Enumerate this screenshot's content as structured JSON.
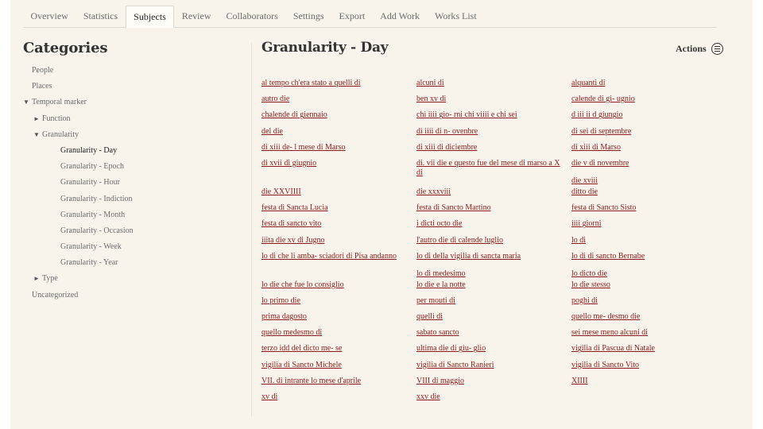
{
  "tabs": [
    "Overview",
    "Statistics",
    "Subjects",
    "Review",
    "Collaborators",
    "Settings",
    "Export",
    "Add Work",
    "Works List"
  ],
  "active_tab": "Subjects",
  "sidebar": {
    "title": "Categories",
    "items": [
      {
        "label": "People",
        "indent": 0,
        "toggle": ""
      },
      {
        "label": "Places",
        "indent": 0,
        "toggle": ""
      },
      {
        "label": "Temporal marker",
        "indent": 0,
        "toggle": "▼"
      },
      {
        "label": "Function",
        "indent": 1,
        "toggle": "►"
      },
      {
        "label": "Granularity",
        "indent": 1,
        "toggle": "▼"
      },
      {
        "label": "Granularity - Day",
        "indent": 2,
        "toggle": "",
        "current": true
      },
      {
        "label": "Granularity - Epoch",
        "indent": 2,
        "toggle": ""
      },
      {
        "label": "Granularity - Hour",
        "indent": 2,
        "toggle": ""
      },
      {
        "label": "Granularity - Indiction",
        "indent": 2,
        "toggle": ""
      },
      {
        "label": "Granularity - Month",
        "indent": 2,
        "toggle": ""
      },
      {
        "label": "Granularity - Occasion",
        "indent": 2,
        "toggle": ""
      },
      {
        "label": "Granularity - Week",
        "indent": 2,
        "toggle": ""
      },
      {
        "label": "Granularity - Year",
        "indent": 2,
        "toggle": ""
      },
      {
        "label": "Type",
        "indent": 1,
        "toggle": "►"
      },
      {
        "label": "Uncategorized",
        "indent": 0,
        "toggle": ""
      }
    ]
  },
  "main": {
    "title": "Granularity - Day",
    "actions_label": "Actions",
    "actions_icon": "menu-circle-icon",
    "link_color": "#8b1a1a"
  },
  "rows": [
    [
      "al tempo ch'era stato a quelli di",
      "alcuni di",
      "alquanti di"
    ],
    [
      "autro die",
      "ben xv di",
      "calende di gi- ugnio"
    ],
    [
      "chalende di giennaio",
      "chi iiii gio- rni chi viiii e chi sei",
      "d iii ii d giungio"
    ],
    [
      "del die",
      "di iiii di n- ovenbre",
      "di sei di septembre"
    ],
    [
      "di xiii de- l mese di Marso",
      "di xiii di diciembre",
      "di xiii di Marso"
    ],
    [
      "di xvii di giugnio",
      "di. vii die e questo fue del mese di marso a X di",
      [
        "die v di novembre",
        "die xviii"
      ]
    ],
    [
      "die XXVIIII",
      "die xxxviii",
      "ditto die"
    ],
    [
      "festa di Sancta Lucia",
      "festa di Sancto Martino",
      "festa di Sancto Sisto"
    ],
    [
      "festa di sancto vito",
      "i dicti octo die",
      "iiii giorni"
    ],
    [
      "iiita die xv di Jugno",
      "l'autro die di calende luglio",
      "lo di"
    ],
    [
      "lo di che li amba- sciadori di Pisa andanno",
      [
        "lo di della vigilia di sancta maria",
        "lo di medesimo"
      ],
      [
        "lo di di sancto Bernabe",
        "lo dicto die"
      ]
    ],
    [
      "lo die che fue lo consiglio",
      "lo die e la notte",
      "lo die stesso"
    ],
    [
      "lo primo die",
      "per mouti di",
      "poghi di"
    ],
    [
      "prima dagosto",
      "quelli di",
      "quello me- desmo die"
    ],
    [
      "quello medesmo di",
      "sabato sancto",
      "sei mese meno alcuni di"
    ],
    [
      "terzo idd del dicto me- se",
      "ultima die di giu- glio",
      "vigilia di Pascua di Natale"
    ],
    [
      "vigilia di Sancto Michele",
      "vigilia di Sancto Ranieri",
      "vigilia di Sancto Vito"
    ],
    [
      "VII. di intrante lo mese d'aprile",
      "VIII di maggio",
      "XIIII"
    ],
    [
      "xv di",
      "xxv die",
      ""
    ]
  ]
}
